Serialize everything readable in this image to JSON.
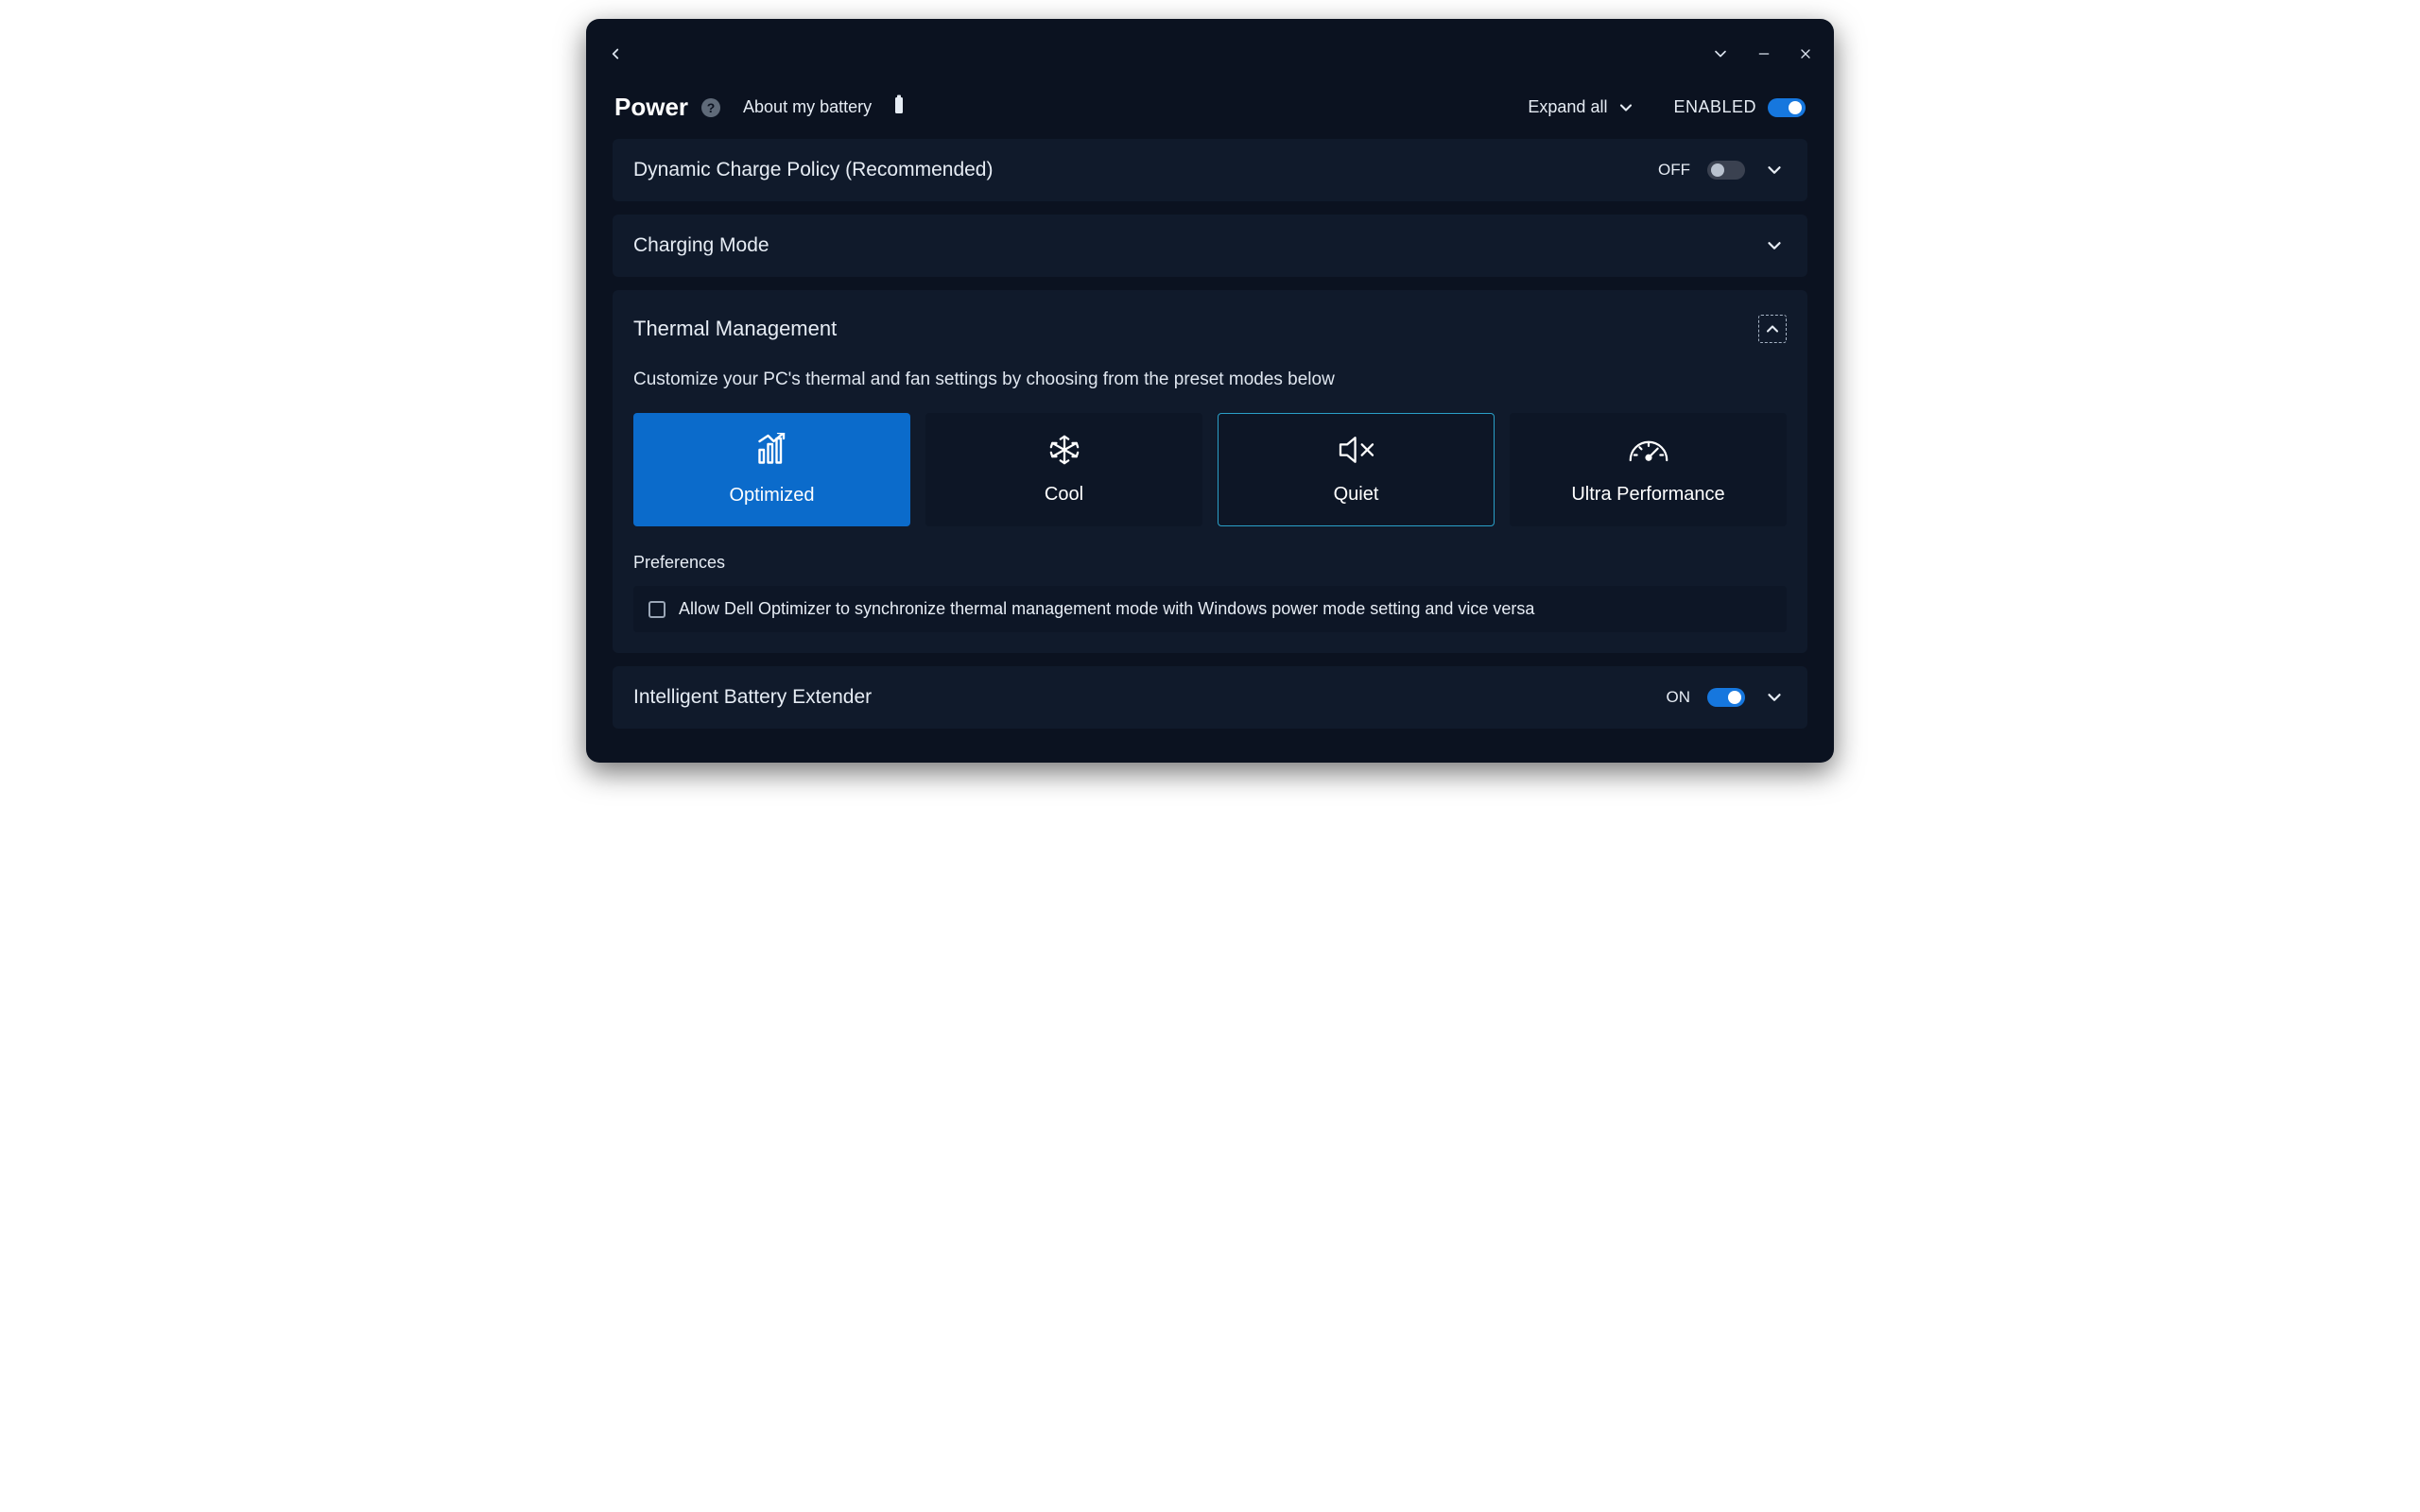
{
  "header": {
    "title": "Power",
    "about_link": "About my battery",
    "expand_all": "Expand all",
    "enabled_label": "ENABLED",
    "enabled_state": true
  },
  "sections": {
    "dynamic_charge": {
      "title": "Dynamic Charge Policy (Recommended)",
      "state_label": "OFF",
      "state": false
    },
    "charging_mode": {
      "title": "Charging Mode"
    },
    "thermal": {
      "title": "Thermal Management",
      "description": "Customize your PC's thermal and fan settings by choosing from the preset modes below",
      "modes": [
        {
          "label": "Optimized",
          "icon": "chart-up",
          "selected": true,
          "hover": false
        },
        {
          "label": "Cool",
          "icon": "snowflake",
          "selected": false,
          "hover": false
        },
        {
          "label": "Quiet",
          "icon": "speaker-mute",
          "selected": false,
          "hover": true
        },
        {
          "label": "Ultra Performance",
          "icon": "gauge",
          "selected": false,
          "hover": false
        }
      ],
      "prefs_label": "Preferences",
      "prefs_checkbox_label": "Allow Dell Optimizer to synchronize thermal management mode with Windows power mode setting and vice versa",
      "prefs_checked": false
    },
    "battery_extender": {
      "title": "Intelligent Battery Extender",
      "state_label": "ON",
      "state": true
    }
  }
}
